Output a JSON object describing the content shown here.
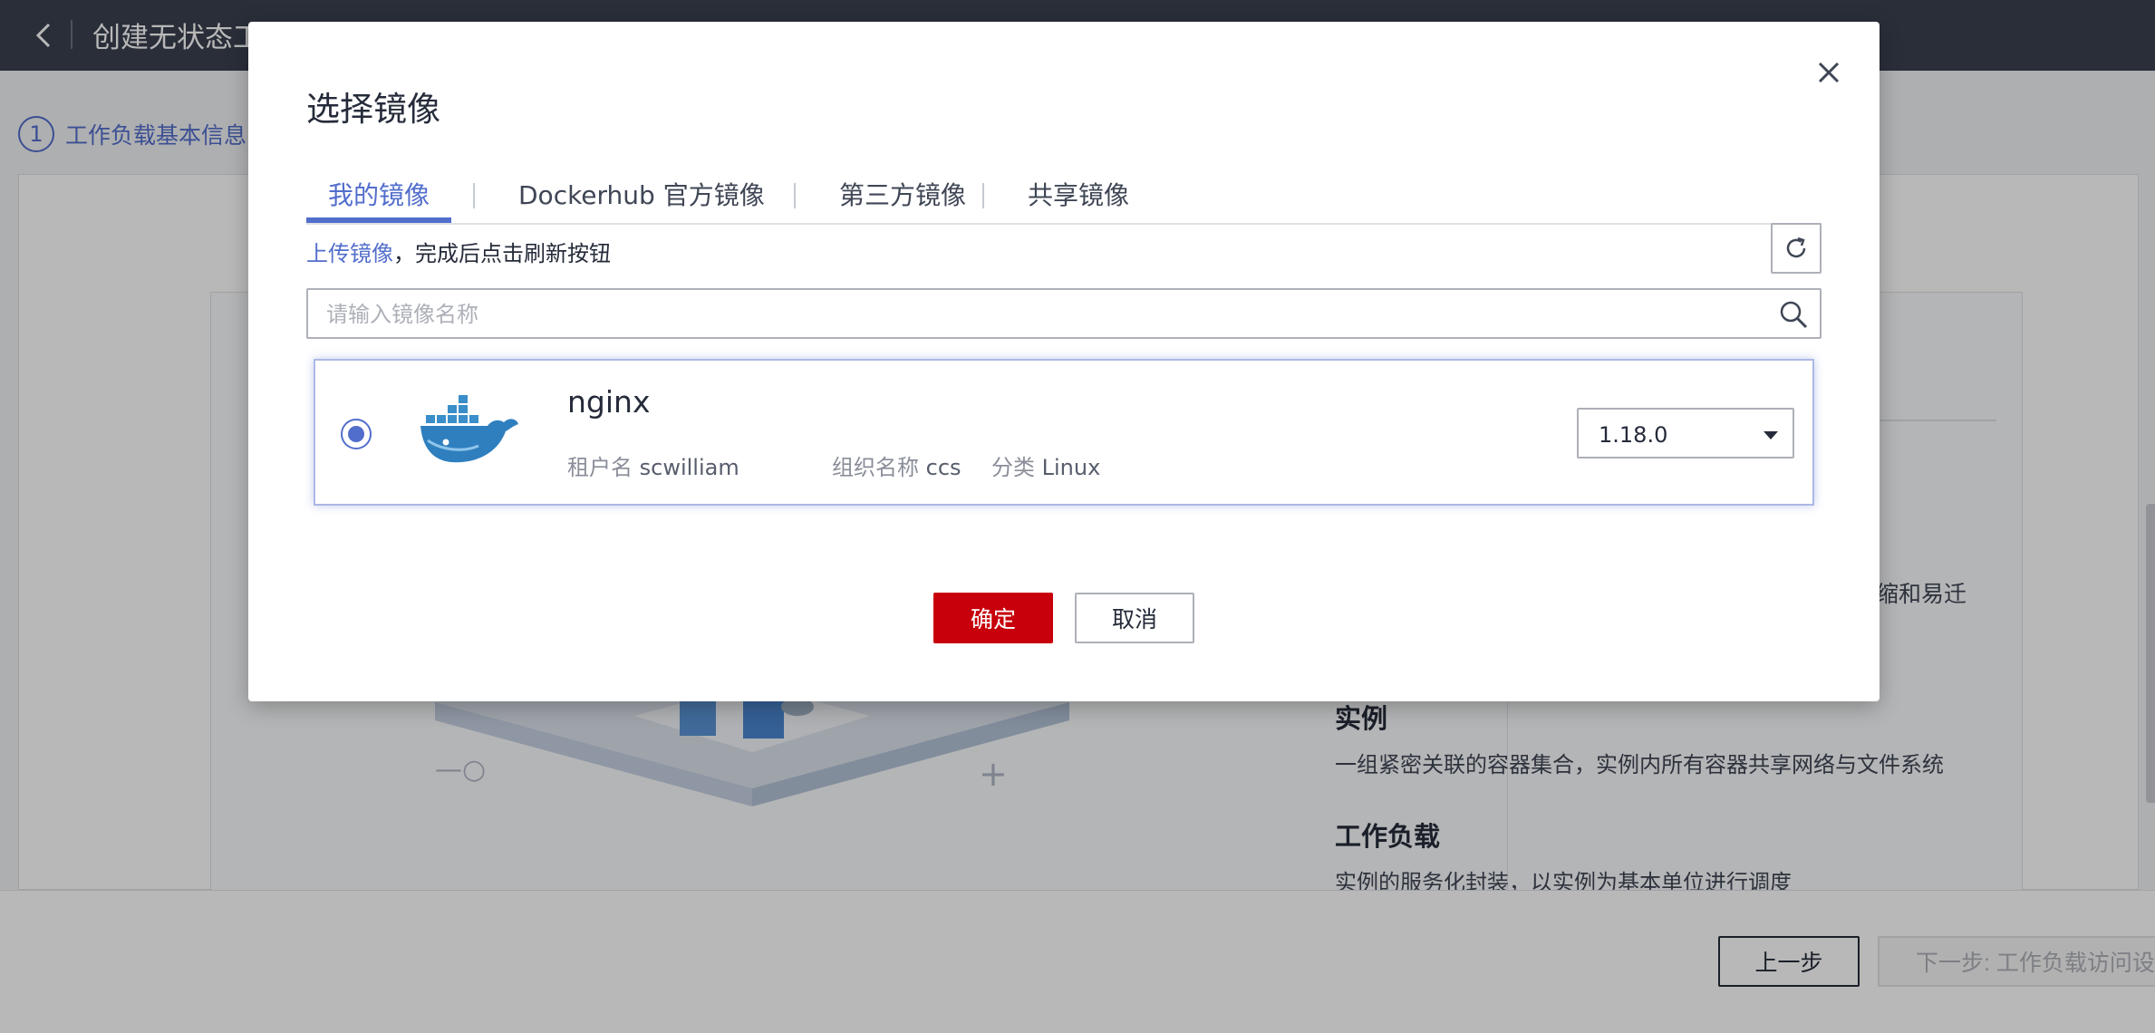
{
  "page": {
    "title": "创建无状态工作负载",
    "step_number": "1",
    "step_label": "工作负载基本信息",
    "fragment_text": "缩和易迁",
    "concepts": [
      {
        "title": "实例",
        "desc": "一组紧密关联的容器集合，实例内所有容器共享网络与文件系统"
      },
      {
        "title": "工作负载",
        "desc": "实例的服务化封装，以实例为基本单位进行调度"
      }
    ],
    "footer": {
      "prev_label": "上一步",
      "next_label": "下一步: 工作负载访问设置"
    }
  },
  "dialog": {
    "title": "选择镜像",
    "tabs": [
      {
        "label": "我的镜像",
        "active": true
      },
      {
        "label": "Dockerhub 官方镜像",
        "active": false
      },
      {
        "label": "第三方镜像",
        "active": false
      },
      {
        "label": "共享镜像",
        "active": false
      }
    ],
    "upload_link": "上传镜像",
    "upload_hint": "，完成后点击刷新按钮",
    "search_placeholder": "请输入镜像名称",
    "image": {
      "name": "nginx",
      "tenant_label": "租户名",
      "tenant": "scwilliam",
      "org_label": "组织名称",
      "org": "ccs",
      "category_label": "分类",
      "category": "Linux",
      "version": "1.18.0",
      "selected": true
    },
    "confirm_label": "确定",
    "cancel_label": "取消"
  },
  "icons": [
    "back-arrow-icon",
    "close-icon",
    "refresh-icon",
    "search-icon",
    "docker-whale-icon",
    "dropdown-caret-icon"
  ],
  "colors": {
    "accent": "#526ecc",
    "primary_button": "#c7000b",
    "topbar": "#3a404f"
  }
}
